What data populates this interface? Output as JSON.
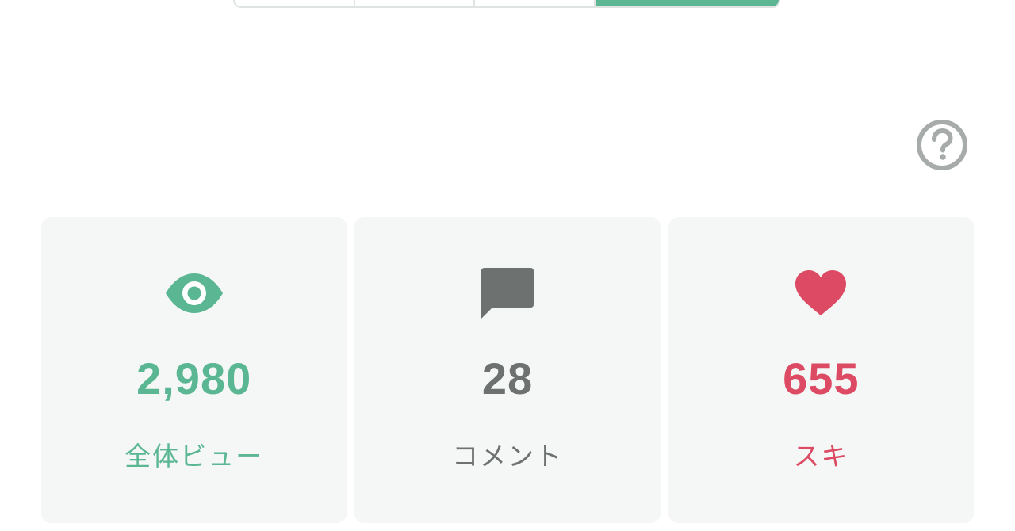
{
  "segments": [
    {
      "active": false
    },
    {
      "active": false
    },
    {
      "active": false
    },
    {
      "active": true
    }
  ],
  "help": {
    "icon": "question-circle-icon"
  },
  "stats": [
    {
      "icon": "eye-icon",
      "value": "2,980",
      "label": "全体ビュー",
      "color": "#5ab693"
    },
    {
      "icon": "comment-icon",
      "value": "28",
      "label": "コメント",
      "color": "#6d7170"
    },
    {
      "icon": "heart-icon",
      "value": "655",
      "label": "スキ",
      "color": "#dc4b63"
    }
  ]
}
